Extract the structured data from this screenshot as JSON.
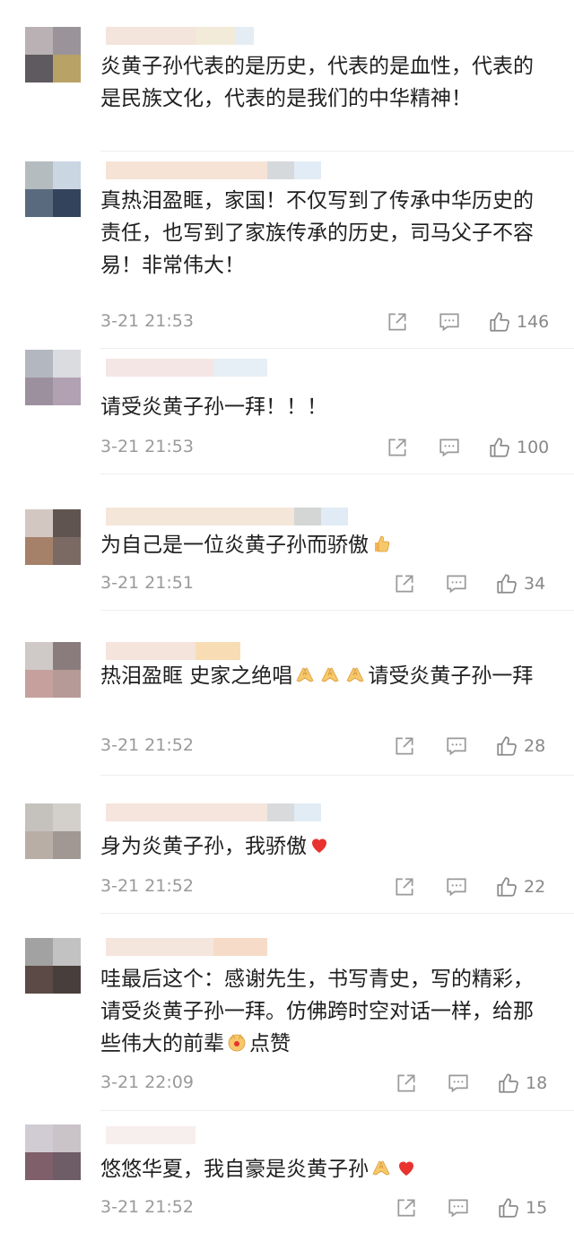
{
  "comments": [
    {
      "text": "炎黄子孙代表的是历史，代表的是血性，代表的是民族文化，代表的是我们的中华精神！",
      "text_after_emoji": "",
      "time": "",
      "likes": "",
      "avatar_colors": [
        "#b9b1b4",
        "#9a949a",
        "#5e5a5f",
        "#b8a265"
      ]
    },
    {
      "text": "真热泪盈眶，家国！不仅写到了传承中华历史的责任，也写到了家族传承的历史，司马父子不容易！非常伟大！",
      "text_after_emoji": "",
      "time": "3-21 21:53",
      "likes": "146",
      "avatar_colors": [
        "#b4bcc0",
        "#cad6e2",
        "#5a6a7e",
        "#33435c"
      ]
    },
    {
      "text": "请受炎黄子孙一拜！！！",
      "text_after_emoji": "",
      "time": "3-21 21:53",
      "likes": "100",
      "avatar_colors": [
        "#b3b7c0",
        "#dadcdf",
        "#9d909e",
        "#b1a1b3"
      ]
    },
    {
      "text": "为自己是一位炎黄子孙而骄傲",
      "text_after_emoji": "",
      "time": "3-21 21:51",
      "likes": "34",
      "avatar_colors": [
        "#d3c7c2",
        "#5f544f",
        "#a48168",
        "#7b6a64"
      ]
    },
    {
      "text": "热泪盈眶 史家之绝唱",
      "text_after_emoji": "请受炎黄子孙一拜",
      "time": "3-21 21:52",
      "likes": "28",
      "avatar_colors": [
        "#cfc9c8",
        "#8a7c7d",
        "#c6a09c",
        "#b69a98"
      ]
    },
    {
      "text": "身为炎黄子孙，我骄傲",
      "text_after_emoji": "",
      "time": "3-21 21:52",
      "likes": "22",
      "avatar_colors": [
        "#c5c2be",
        "#d3d0cc",
        "#b9aea6",
        "#a19893"
      ]
    },
    {
      "text": "哇最后这个：感谢先生，书写青史，写的精彩，请受炎黄子孙一拜。仿佛跨时空对话一样，给那些伟大的前辈",
      "text_after_emoji": "点赞",
      "time": "3-21 22:09",
      "likes": "18",
      "avatar_colors": [
        "#a3a2a3",
        "#c3c2c2",
        "#5b4a45",
        "#483f3c"
      ]
    },
    {
      "text": "悠悠华夏，我自豪是炎黄子孙",
      "text_after_emoji": "",
      "time": "3-21 21:52",
      "likes": "15",
      "avatar_colors": [
        "#d1ccd3",
        "#cac3c8",
        "#7e5f6a",
        "#6e5c67"
      ]
    }
  ],
  "icons": {
    "share": "share-icon",
    "reply": "comment-icon",
    "like": "thumbs-up-icon",
    "emoji_hands": "praying-hands-emoji",
    "emoji_heart": "red-heart-emoji",
    "emoji_thumb": "thumbs-up-emoji",
    "emoji_wow": "celebrating-hands-emoji"
  },
  "colors": {
    "text": "#1f1f1f",
    "meta": "#9a9a9a",
    "heart": "#e8332e"
  }
}
